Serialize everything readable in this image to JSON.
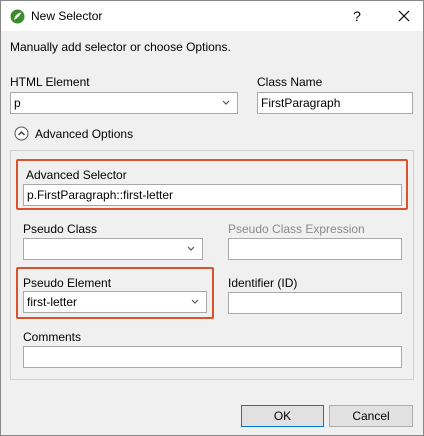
{
  "window": {
    "title": "New Selector",
    "help_label": "?"
  },
  "intro": "Manually add selector or choose Options.",
  "fields": {
    "html_element": {
      "label": "HTML Element",
      "value": "p"
    },
    "class_name": {
      "label": "Class Name",
      "value": "FirstParagraph"
    }
  },
  "advanced": {
    "toggle_label": "Advanced Options",
    "selector": {
      "label": "Advanced Selector",
      "value": "p.FirstParagraph::first-letter"
    },
    "pseudo_class": {
      "label": "Pseudo Class",
      "value": ""
    },
    "pseudo_class_expression": {
      "label": "Pseudo Class Expression",
      "value": ""
    },
    "pseudo_element": {
      "label": "Pseudo Element",
      "value": "first-letter"
    },
    "identifier": {
      "label": "Identifier (ID)",
      "value": ""
    },
    "comments": {
      "label": "Comments",
      "value": ""
    }
  },
  "buttons": {
    "ok": "OK",
    "cancel": "Cancel"
  },
  "colors": {
    "highlight": "#d9532c",
    "app_icon": "#3c8c2e"
  }
}
